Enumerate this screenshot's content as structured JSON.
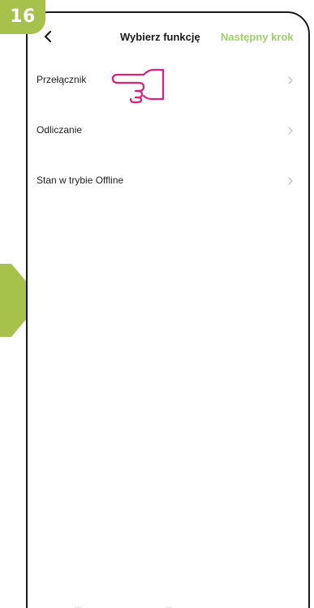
{
  "step_badge": {
    "number": "16"
  },
  "header": {
    "back_icon": "chevron-left-icon",
    "title": "Wybierz funkcję",
    "next_label": "Następny krok"
  },
  "list": {
    "items": [
      {
        "label": "Przełącznik",
        "icon": "chevron-right-icon"
      },
      {
        "label": "Odliczanie",
        "icon": "chevron-right-icon"
      },
      {
        "label": "Stan w trybie Offline",
        "icon": "chevron-right-icon"
      }
    ]
  },
  "overlay": {
    "hand_icon": "pointing-hand-icon",
    "hand_color": "#e0207a"
  },
  "colors": {
    "badge": "#a6c24a",
    "arrow": "#a6c24a",
    "accent_next": "#9ed069",
    "frame": "#1a1a1a"
  },
  "nav": {
    "icons": [
      "recent-apps-icon",
      "home-icon",
      "back-nav-icon"
    ]
  }
}
